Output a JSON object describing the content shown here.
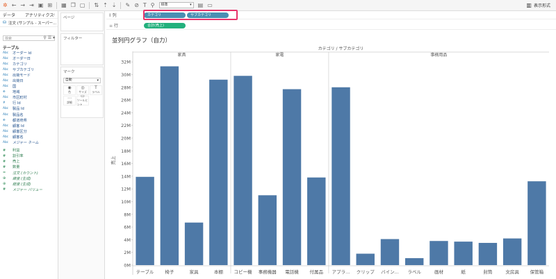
{
  "toolbar": {
    "fit_select": "標準",
    "present_label": "表示形式"
  },
  "data_pane": {
    "tab_data": "データ",
    "tab_analytics": "アナリティクス",
    "datasource": "注文 (サンプル - スーパー...",
    "search_placeholder": "検索",
    "section_label": "テーブル",
    "dimensions": [
      {
        "type": "Abc",
        "name": "オーダー Id"
      },
      {
        "type": "Abc",
        "name": "オーダー日"
      },
      {
        "type": "Abc",
        "name": "カテゴリ"
      },
      {
        "type": "Abc",
        "name": "サブカテゴリ"
      },
      {
        "type": "Abc",
        "name": "出荷モード"
      },
      {
        "type": "Abc",
        "name": "出荷日"
      },
      {
        "type": "Abc",
        "name": "国"
      },
      {
        "type": "⊕",
        "name": "地域"
      },
      {
        "type": "Abc",
        "name": "市区町村"
      },
      {
        "type": "#",
        "name": "行 Id"
      },
      {
        "type": "Abc",
        "name": "製品 Id"
      },
      {
        "type": "Abc",
        "name": "製品名"
      },
      {
        "type": "⊕",
        "name": "都道府県"
      },
      {
        "type": "Abc",
        "name": "顧客 Id"
      },
      {
        "type": "Abc",
        "name": "顧客区分"
      },
      {
        "type": "Abc",
        "name": "顧客名"
      },
      {
        "type": "Abc",
        "name": "メジャー ネーム"
      }
    ],
    "measures": [
      {
        "type": "#",
        "name": "利益"
      },
      {
        "type": "#",
        "name": "割引率"
      },
      {
        "type": "#",
        "name": "売上"
      },
      {
        "type": "#",
        "name": "数量"
      },
      {
        "type": "=",
        "name": "注文 (カウント)"
      },
      {
        "type": "⊕",
        "name": "緯度 (生成)"
      },
      {
        "type": "⊕",
        "name": "経度 (生成)"
      },
      {
        "type": "#",
        "name": "メジャー バリュー"
      }
    ]
  },
  "side": {
    "pages_label": "ページ",
    "filters_label": "フィルター",
    "marks_label": "マーク",
    "marks_type": "自動",
    "marks_buttons": [
      {
        "icon": "◉",
        "label": "色"
      },
      {
        "icon": "◎",
        "label": "サイズ"
      },
      {
        "icon": "T",
        "label": "ラベル"
      },
      {
        "icon": "⋯",
        "label": "詳細"
      },
      {
        "icon": "▭",
        "label": "ツールヒント"
      }
    ]
  },
  "shelves": {
    "columns_label": "列",
    "rows_label": "行",
    "columns_pills": [
      "カテゴリ",
      "サブカテゴリ"
    ],
    "rows_pills": [
      "合計(売上)"
    ]
  },
  "view": {
    "sheet_title": "並列円グラフ（自力）"
  },
  "chart_data": {
    "type": "bar",
    "title": "カテゴリ / サブカテゴリ",
    "ylabel": "売上",
    "ylim": [
      0,
      33000000
    ],
    "yticks": [
      0,
      2000000,
      4000000,
      6000000,
      8000000,
      10000000,
      12000000,
      14000000,
      16000000,
      18000000,
      20000000,
      22000000,
      24000000,
      26000000,
      28000000,
      30000000,
      32000000
    ],
    "ytick_labels": [
      "0M",
      "2M",
      "4M",
      "6M",
      "8M",
      "10M",
      "12M",
      "14M",
      "16M",
      "18M",
      "20M",
      "22M",
      "24M",
      "26M",
      "28M",
      "30M",
      "32M"
    ],
    "bar_color": "#4e79a7",
    "groups": [
      {
        "name": "家具",
        "categories": [
          "テーブル",
          "椅子",
          "家具",
          "本棚"
        ],
        "values": [
          13900000,
          31300000,
          6700000,
          29200000
        ]
      },
      {
        "name": "家電",
        "categories": [
          "コピー機",
          "事務機器",
          "電話機",
          "付属品"
        ],
        "values": [
          29800000,
          11000000,
          27700000,
          13800000
        ]
      },
      {
        "name": "事務用品",
        "categories": [
          "アプラ...",
          "クリップ",
          "バイン...",
          "ラベル",
          "画材",
          "紙",
          "封筒",
          "文房具",
          "保管箱"
        ],
        "values": [
          28000000,
          1800000,
          4100000,
          1100000,
          3800000,
          3700000,
          3500000,
          4200000,
          13200000
        ]
      }
    ]
  }
}
